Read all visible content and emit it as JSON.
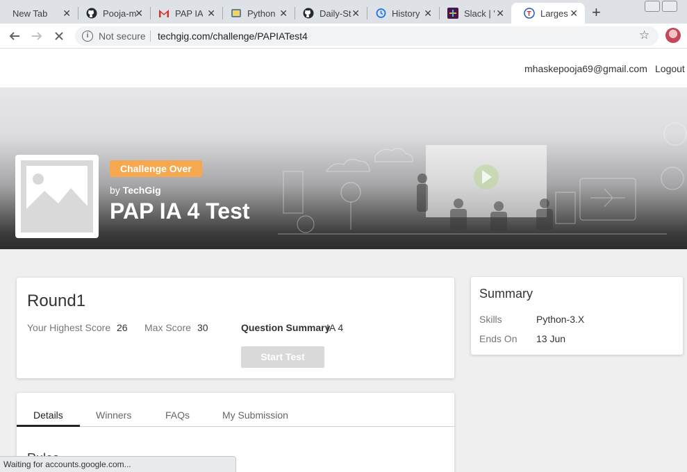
{
  "browser": {
    "tabs": [
      {
        "title": "New Tab",
        "icon": "none"
      },
      {
        "title": "Pooja-m",
        "icon": "github-icon"
      },
      {
        "title": "PAP IA",
        "icon": "gmail-icon"
      },
      {
        "title": "Python",
        "icon": "python-icon"
      },
      {
        "title": "Daily-St",
        "icon": "github-icon"
      },
      {
        "title": "History",
        "icon": "history-icon"
      },
      {
        "title": "Slack | '",
        "icon": "slack-icon"
      },
      {
        "title": "Largest",
        "icon": "techgig-icon"
      }
    ],
    "security_label": "Not secure",
    "url": "techgig.com/challenge/PAPIATest4"
  },
  "header": {
    "email": "mhaskepooja69@gmail.com",
    "logout": "Logout"
  },
  "hero": {
    "badge": "Challenge Over",
    "by": "by",
    "author": "TechGig",
    "title": "PAP IA 4 Test",
    "badge_color": "#f5a84f"
  },
  "round": {
    "title": "Round1",
    "highest_label": "Your Highest Score",
    "highest_value": "26",
    "max_label": "Max Score",
    "max_value": "30",
    "summary_label": "Question Summary",
    "summary_value": "IA 4",
    "start_label": "Start Test"
  },
  "summary": {
    "title": "Summary",
    "skills_label": "Skills",
    "skills_value": "Python-3.X",
    "ends_label": "Ends On",
    "ends_value": "13 Jun"
  },
  "details": {
    "tabs": [
      "Details",
      "Winners",
      "FAQs",
      "My Submission"
    ],
    "heading": "Rules"
  },
  "status": "Waiting for accounts.google.com..."
}
